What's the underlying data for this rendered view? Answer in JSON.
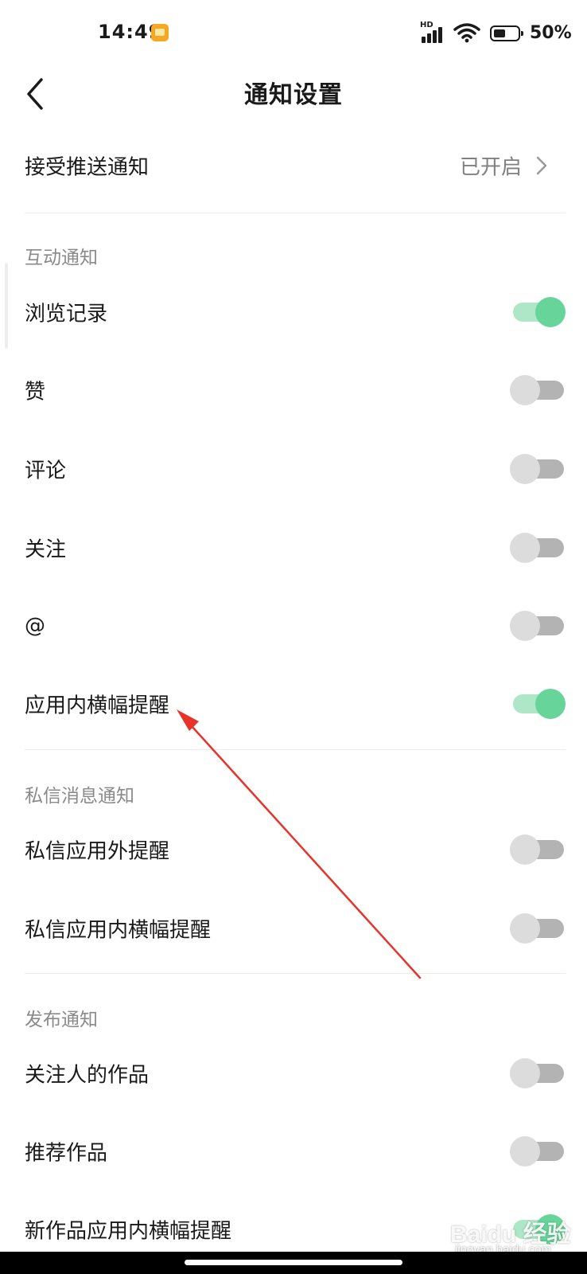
{
  "status_bar": {
    "time": "14:49",
    "network_badge": "HD",
    "battery_text": "50%",
    "icons": [
      "notification-app-icon",
      "signal-icon",
      "wifi-icon",
      "battery-icon"
    ]
  },
  "header": {
    "title": "通知设置",
    "back_icon": "chevron-left-icon"
  },
  "push": {
    "label": "接受推送通知",
    "value": "已开启"
  },
  "sections": [
    {
      "title": "互动通知",
      "items": [
        {
          "label": "浏览记录",
          "on": true
        },
        {
          "label": "赞",
          "on": false
        },
        {
          "label": "评论",
          "on": false
        },
        {
          "label": "关注",
          "on": false
        },
        {
          "label": "@",
          "on": false
        },
        {
          "label": "应用内横幅提醒",
          "on": true
        }
      ]
    },
    {
      "title": "私信消息通知",
      "items": [
        {
          "label": "私信应用外提醒",
          "on": false
        },
        {
          "label": "私信应用内横幅提醒",
          "on": false
        }
      ]
    },
    {
      "title": "发布通知",
      "items": [
        {
          "label": "关注人的作品",
          "on": false
        },
        {
          "label": "推荐作品",
          "on": false
        },
        {
          "label": "新作品应用内横幅提醒",
          "on": true
        }
      ]
    }
  ],
  "watermark": {
    "main": "Baidu 经验",
    "sub": "jingyan.baidu.com"
  },
  "colors": {
    "toggle_on": "#67d49a",
    "toggle_on_track": "#aee6c8",
    "toggle_off": "#dcdcdc",
    "annotation_arrow": "#e8332b"
  }
}
